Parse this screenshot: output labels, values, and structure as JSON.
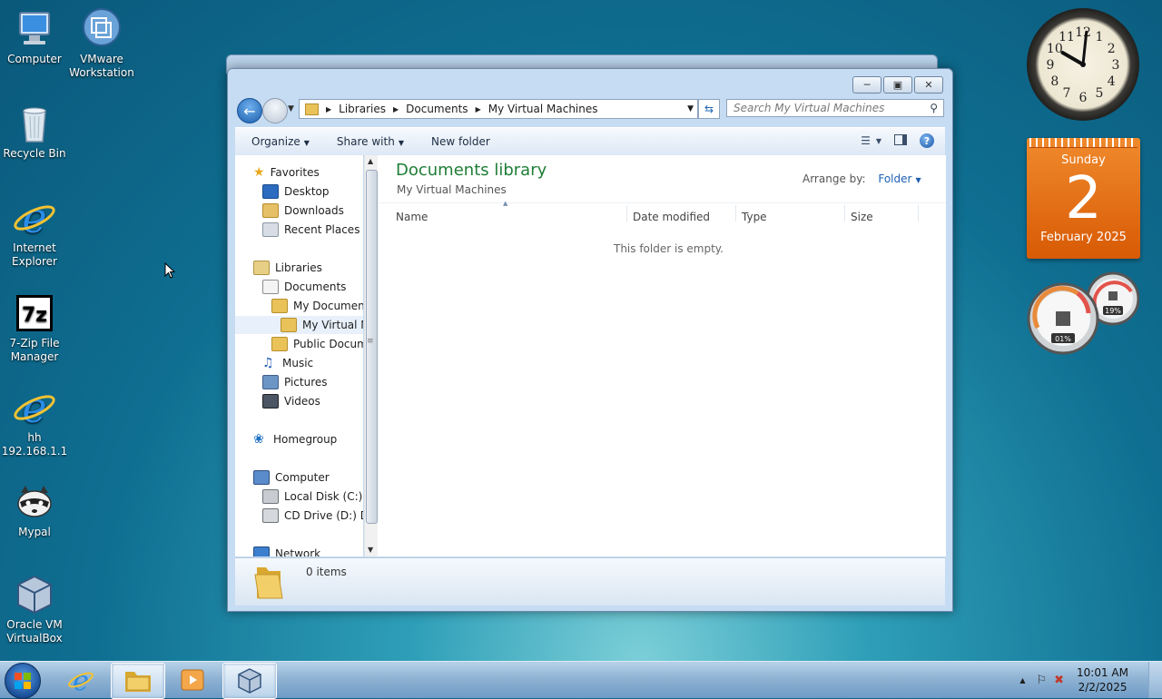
{
  "desktop_icons": [
    {
      "label": "Computer"
    },
    {
      "label": "VMware\nWorkstation"
    },
    {
      "label": "Recycle Bin"
    },
    {
      "label": "Internet\nExplorer"
    },
    {
      "label": "7-Zip File\nManager"
    },
    {
      "label": "hh\n192.168.1.1"
    },
    {
      "label": "Mypal"
    },
    {
      "label": "Oracle VM\nVirtualBox"
    }
  ],
  "window": {
    "address": {
      "crumbs": [
        "Libraries",
        "Documents",
        "My Virtual Machines"
      ]
    },
    "search_placeholder": "Search My Virtual Machines",
    "toolbar": {
      "organize": "Organize",
      "share_with": "Share with",
      "new_folder": "New folder"
    },
    "nav": {
      "favorites": "Favorites",
      "desktop": "Desktop",
      "downloads": "Downloads",
      "recent": "Recent Places",
      "libraries": "Libraries",
      "documents": "Documents",
      "my_documents": "My Documents",
      "my_virtual": "My Virtual M",
      "public_docs": "Public Docume",
      "music": "Music",
      "pictures": "Pictures",
      "videos": "Videos",
      "homegroup": "Homegroup",
      "computer": "Computer",
      "local_disk": "Local Disk (C:)",
      "cd_drive": "CD Drive (D:) Dre",
      "network": "Network"
    },
    "content": {
      "title": "Documents library",
      "subtitle": "My Virtual Machines",
      "arrange_label": "Arrange by:",
      "arrange_value": "Folder",
      "columns": [
        "Name",
        "Date modified",
        "Type",
        "Size"
      ],
      "empty_message": "This folder is empty."
    },
    "details": {
      "count": "0 items"
    }
  },
  "taskbar": {
    "time": "10:01 AM",
    "date": "2/2/2025"
  },
  "gadgets": {
    "calendar": {
      "day": "Sunday",
      "date": "2",
      "month": "February 2025"
    },
    "clock_numerals": [
      "12",
      "1",
      "2",
      "3",
      "4",
      "5",
      "6",
      "7",
      "8",
      "9",
      "10",
      "11"
    ],
    "meter": {
      "cpu": "01%",
      "memory": "19%"
    }
  },
  "colors": {
    "accent_green": "#1e7e36",
    "link_blue": "#1e5fb4",
    "calendar_orange": "#e8710a"
  }
}
